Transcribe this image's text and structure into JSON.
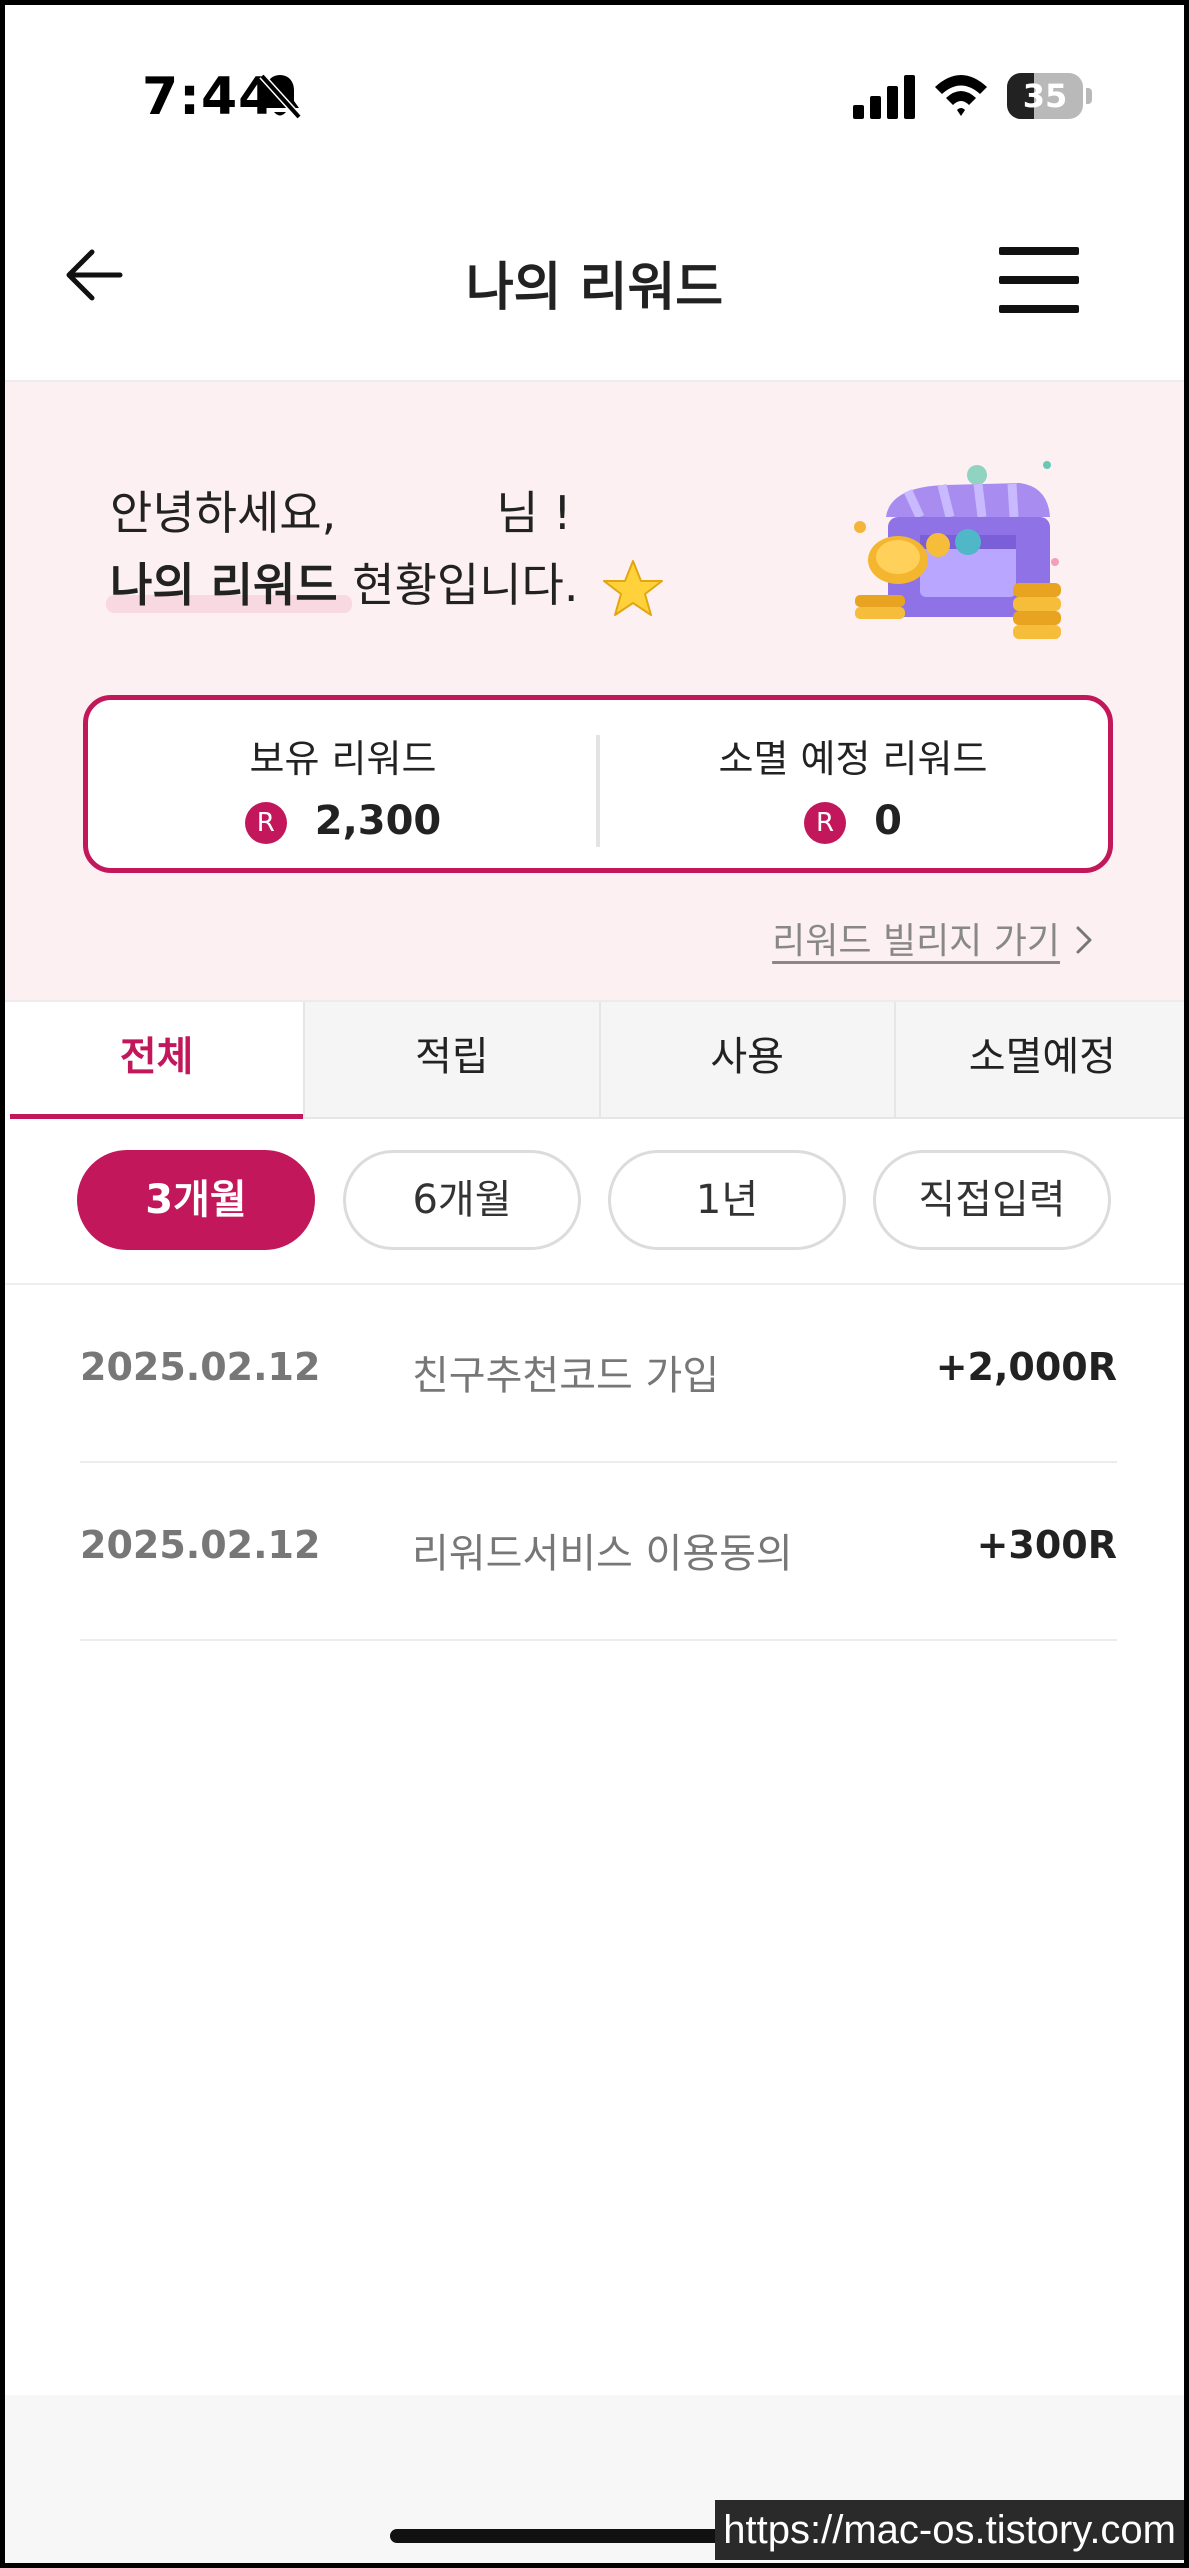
{
  "status_bar": {
    "time": "7:44",
    "battery_level": "35",
    "battery_fraction": 0.35
  },
  "header": {
    "title": "나의 리워드"
  },
  "hero": {
    "greeting_prefix": "안녕하세요,",
    "greeting_suffix": "님 !",
    "reward_label": "나의 리워드",
    "status_suffix": " 현황입니다."
  },
  "summary": {
    "held_label": "보유 리워드",
    "held_value": "2,300",
    "expiring_label": "소멸 예정 리워드",
    "expiring_value": "0",
    "badge_letter": "R"
  },
  "village_link": "리워드 빌리지 가기",
  "tabs": [
    {
      "label": "전체",
      "active": true
    },
    {
      "label": "적립",
      "active": false
    },
    {
      "label": "사용",
      "active": false
    },
    {
      "label": "소멸예정",
      "active": false
    }
  ],
  "periods": [
    {
      "label": "3개월",
      "active": true
    },
    {
      "label": "6개월",
      "active": false
    },
    {
      "label": "1년",
      "active": false
    },
    {
      "label": "직접입력",
      "active": false
    }
  ],
  "history": [
    {
      "date": "2025.02.12",
      "description": "친구추천코드 가입",
      "amount": "+2,000R"
    },
    {
      "date": "2025.02.12",
      "description": "리워드서비스 이용동의",
      "amount": "+300R"
    }
  ],
  "watermark": "https://mac-os.tistory.com",
  "colors": {
    "accent": "#c2185b",
    "hero_bg": "#fdf0f3"
  }
}
